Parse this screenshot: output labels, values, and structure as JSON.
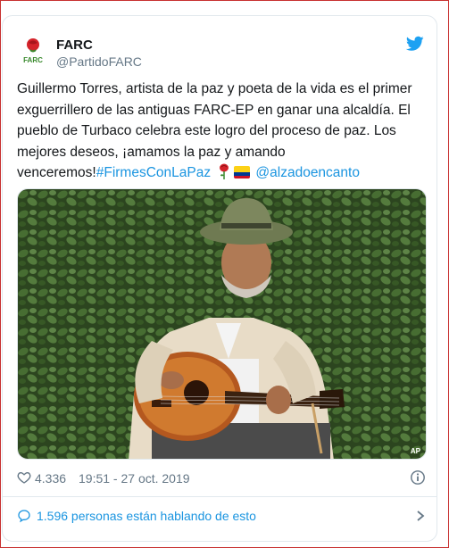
{
  "account": {
    "name": "FARC",
    "handle": "@PartidoFARC",
    "avatar_label": "FARC",
    "avatar_icon": "rose-logo-icon"
  },
  "tweet": {
    "text_main": "Guillermo Torres, artista de la paz y poeta de la vida es el primer exguerrillero de las antiguas FARC-EP en ganar una alcaldía. El pueblo de Turbaco celebra este logro del proceso de paz. Los mejores deseos, ¡amamos la paz y amando venceremos!",
    "hashtag": "#FirmesConLaPaz",
    "emojis": [
      "rose-emoji",
      "colombia-flag-emoji"
    ],
    "mention": "@alzadoencanto"
  },
  "media": {
    "credit": "AP",
    "description_icon": "photo"
  },
  "meta": {
    "likes": "4.336",
    "timestamp": "19:51 - 27 oct. 2019"
  },
  "talking": {
    "label": "1.596 personas están hablando de esto"
  },
  "colors": {
    "link": "#1b95e0",
    "text": "#14171a",
    "muted": "#657786",
    "border": "#e1e8ed",
    "brand_red": "#c8312f"
  }
}
